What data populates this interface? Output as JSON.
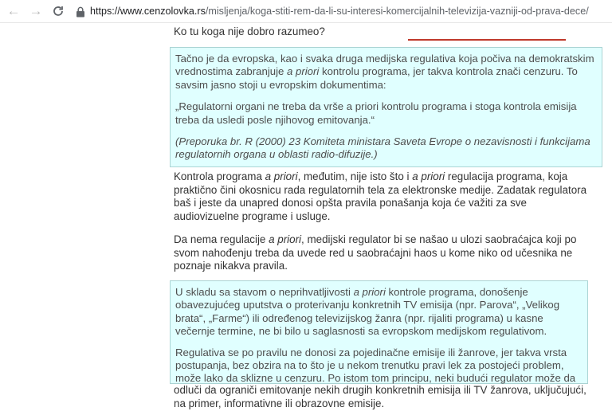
{
  "browser": {
    "back_icon": "arrow-left-icon",
    "forward_icon": "arrow-right-icon",
    "reload_icon": "reload-icon",
    "lock_icon": "lock-icon",
    "url_host": "https://www.cenzolovka.rs",
    "url_path": "/misljenja/koga-stiti-rem-da-li-su-interesi-komercijalnih-televizija-vazniji-od-prava-dece/"
  },
  "article": {
    "question": "Ko tu koga nije dobro razumeo?",
    "box1": {
      "p1_a": "Tačno je da evropska, kao i svaka druga medijska regulativa koja počiva na demokratskim vrednostima zabranjuje ",
      "p1_em": "a priori",
      "p1_b": " kontrolu programa, jer takva kontrola znači cenzuru. To savsim jasno stoji u evropskim dokumentima:",
      "quote": "„Regulatorni organi ne treba da vrše a priori kontrolu programa i stoga kontrola emisija treba da usledi posle njihovog emitovanja.“",
      "citation": "(Preporuka br. R (2000) 23 Komiteta ministara Saveta Evrope o nezavisnosti i funkcijama regulatornih organa u oblasti radio-difuzije.)"
    },
    "para1": {
      "a": "Kontrola programa ",
      "em1": "a priori",
      "b": ", međutim, nije isto što i ",
      "em2": "a priori",
      "c": " regulacija programa, koja praktično čini okosnicu rada regulatornih tela za elektronske medije. Zadatak regulatora baš i jeste da unapred donosi opšta pravila ponašanja koja će važiti za sve audiovizuelne programe i usluge."
    },
    "para2": {
      "a": "Da nema regulacije ",
      "em": "a priori",
      "b": ", medijski regulator bi se našao u ulozi  saobraćajca koji po svom nahođenju treba da uvede red u saobraćajni haos u kome niko od učesnika ne poznaje nikakva pravila."
    },
    "box2": {
      "p1_a": "U skladu sa stavom o neprihvatljivosti ",
      "p1_em": "a priori",
      "p1_b": " kontrole programa, donošenje obavezujućeg uputstva o proterivanju konkretnih TV emisija (npr. Parova“, „Velikog brata“, „Farme“) ili određenog televizijskog žanra (npr. rijaliti programa) u kasne večernje termine, ne bi bilo u saglasnosti sa evropskom medijskom regulativom.",
      "p2": "Regulativa se po pravilu ne donosi za pojedinačne emisije ili žanrove, jer takva vrsta postupanja, bez obzira na to što je u nekom trenutku pravi lek za postojeći problem, može lako da sklizne u cenzuru. Po istom tom principu, neki budući regulator može da"
    },
    "tail": "odluči da ograniči emitovanje nekih drugih konkretnih emisija ili TV žanrova, uključujući, na primer, informativne ili obrazovne emisije."
  },
  "colors": {
    "box_background": "#e0ffff",
    "box_border": "#aad4d4",
    "accent_rule": "#c0392b"
  }
}
